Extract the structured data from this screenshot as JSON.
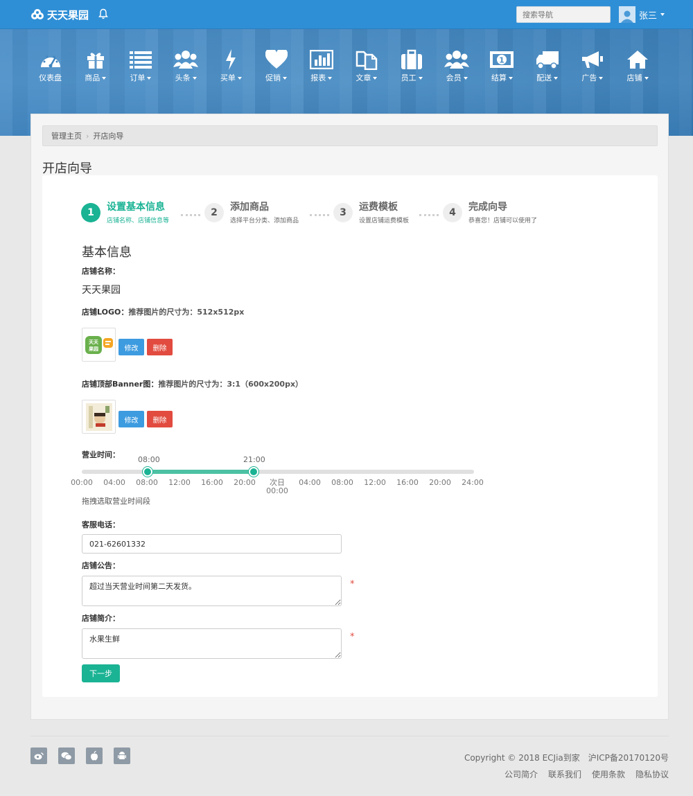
{
  "header": {
    "brand": "天天果园",
    "search_placeholder": "搜索导航",
    "username": "张三"
  },
  "nav": [
    {
      "label": "仪表盘",
      "icon": "dashboard-icon",
      "dropdown": false
    },
    {
      "label": "商品",
      "icon": "gift-icon",
      "dropdown": true
    },
    {
      "label": "订单",
      "icon": "list-icon",
      "dropdown": true
    },
    {
      "label": "头条",
      "icon": "group-icon",
      "dropdown": true
    },
    {
      "label": "买单",
      "icon": "bolt-icon",
      "dropdown": true
    },
    {
      "label": "促销",
      "icon": "heart-icon",
      "dropdown": true
    },
    {
      "label": "报表",
      "icon": "bar-chart-icon",
      "dropdown": true
    },
    {
      "label": "文章",
      "icon": "documents-icon",
      "dropdown": true
    },
    {
      "label": "员工",
      "icon": "briefcase-icon",
      "dropdown": true
    },
    {
      "label": "会员",
      "icon": "group-icon",
      "dropdown": true
    },
    {
      "label": "结算",
      "icon": "money-icon",
      "dropdown": true
    },
    {
      "label": "配送",
      "icon": "truck-icon",
      "dropdown": true
    },
    {
      "label": "广告",
      "icon": "megaphone-icon",
      "dropdown": true
    },
    {
      "label": "店铺",
      "icon": "home-icon",
      "dropdown": true
    }
  ],
  "breadcrumb": {
    "home": "管理主页",
    "current": "开店向导"
  },
  "page_title": "开店向导",
  "steps": [
    {
      "num": "1",
      "title": "设置基本信息",
      "sub": "店铺名称、店铺信息等",
      "active": true
    },
    {
      "num": "2",
      "title": "添加商品",
      "sub": "选择平台分类、添加商品",
      "active": false
    },
    {
      "num": "3",
      "title": "运费模板",
      "sub": "设置店铺运费模板",
      "active": false
    },
    {
      "num": "4",
      "title": "完成向导",
      "sub": "恭喜您！店铺可以使用了",
      "active": false
    }
  ],
  "form": {
    "section_title": "基本信息",
    "store_name_label": "店铺名称：",
    "store_name_value": "天天果园",
    "logo_label": "店铺LOGO：",
    "logo_hint": "推荐图片的尺寸为：512x512px",
    "logo_text": "天天果园",
    "banner_label": "店铺顶部Banner图：",
    "banner_hint": "推荐图片的尺寸为：3:1（600x200px）",
    "edit_label": "修改",
    "delete_label": "删除",
    "hours_label": "营业时间：",
    "hours_start": "08:00",
    "hours_end": "21:00",
    "hours_ticks": [
      "00:00",
      "04:00",
      "08:00",
      "12:00",
      "16:00",
      "20:00",
      "次日\n00:00",
      "04:00",
      "08:00",
      "12:00",
      "16:00",
      "20:00",
      "24:00"
    ],
    "hours_help": "拖拽选取营业时间段",
    "phone_label": "客服电话：",
    "phone_value": "021-62601332",
    "notice_label": "店铺公告：",
    "notice_value": "超过当天营业时间第二天发货。",
    "intro_label": "店铺简介：",
    "intro_value": "水果生鲜",
    "required_mark": "*",
    "next_label": "下一步"
  },
  "footer": {
    "copyright": "Copyright © 2018 ECJia到家",
    "icp": "沪ICP备20170120号",
    "links": [
      "公司简介",
      "联系我们",
      "使用条款",
      "隐私协议"
    ],
    "social": [
      "weibo-icon",
      "wechat-icon",
      "apple-icon",
      "android-icon"
    ]
  }
}
